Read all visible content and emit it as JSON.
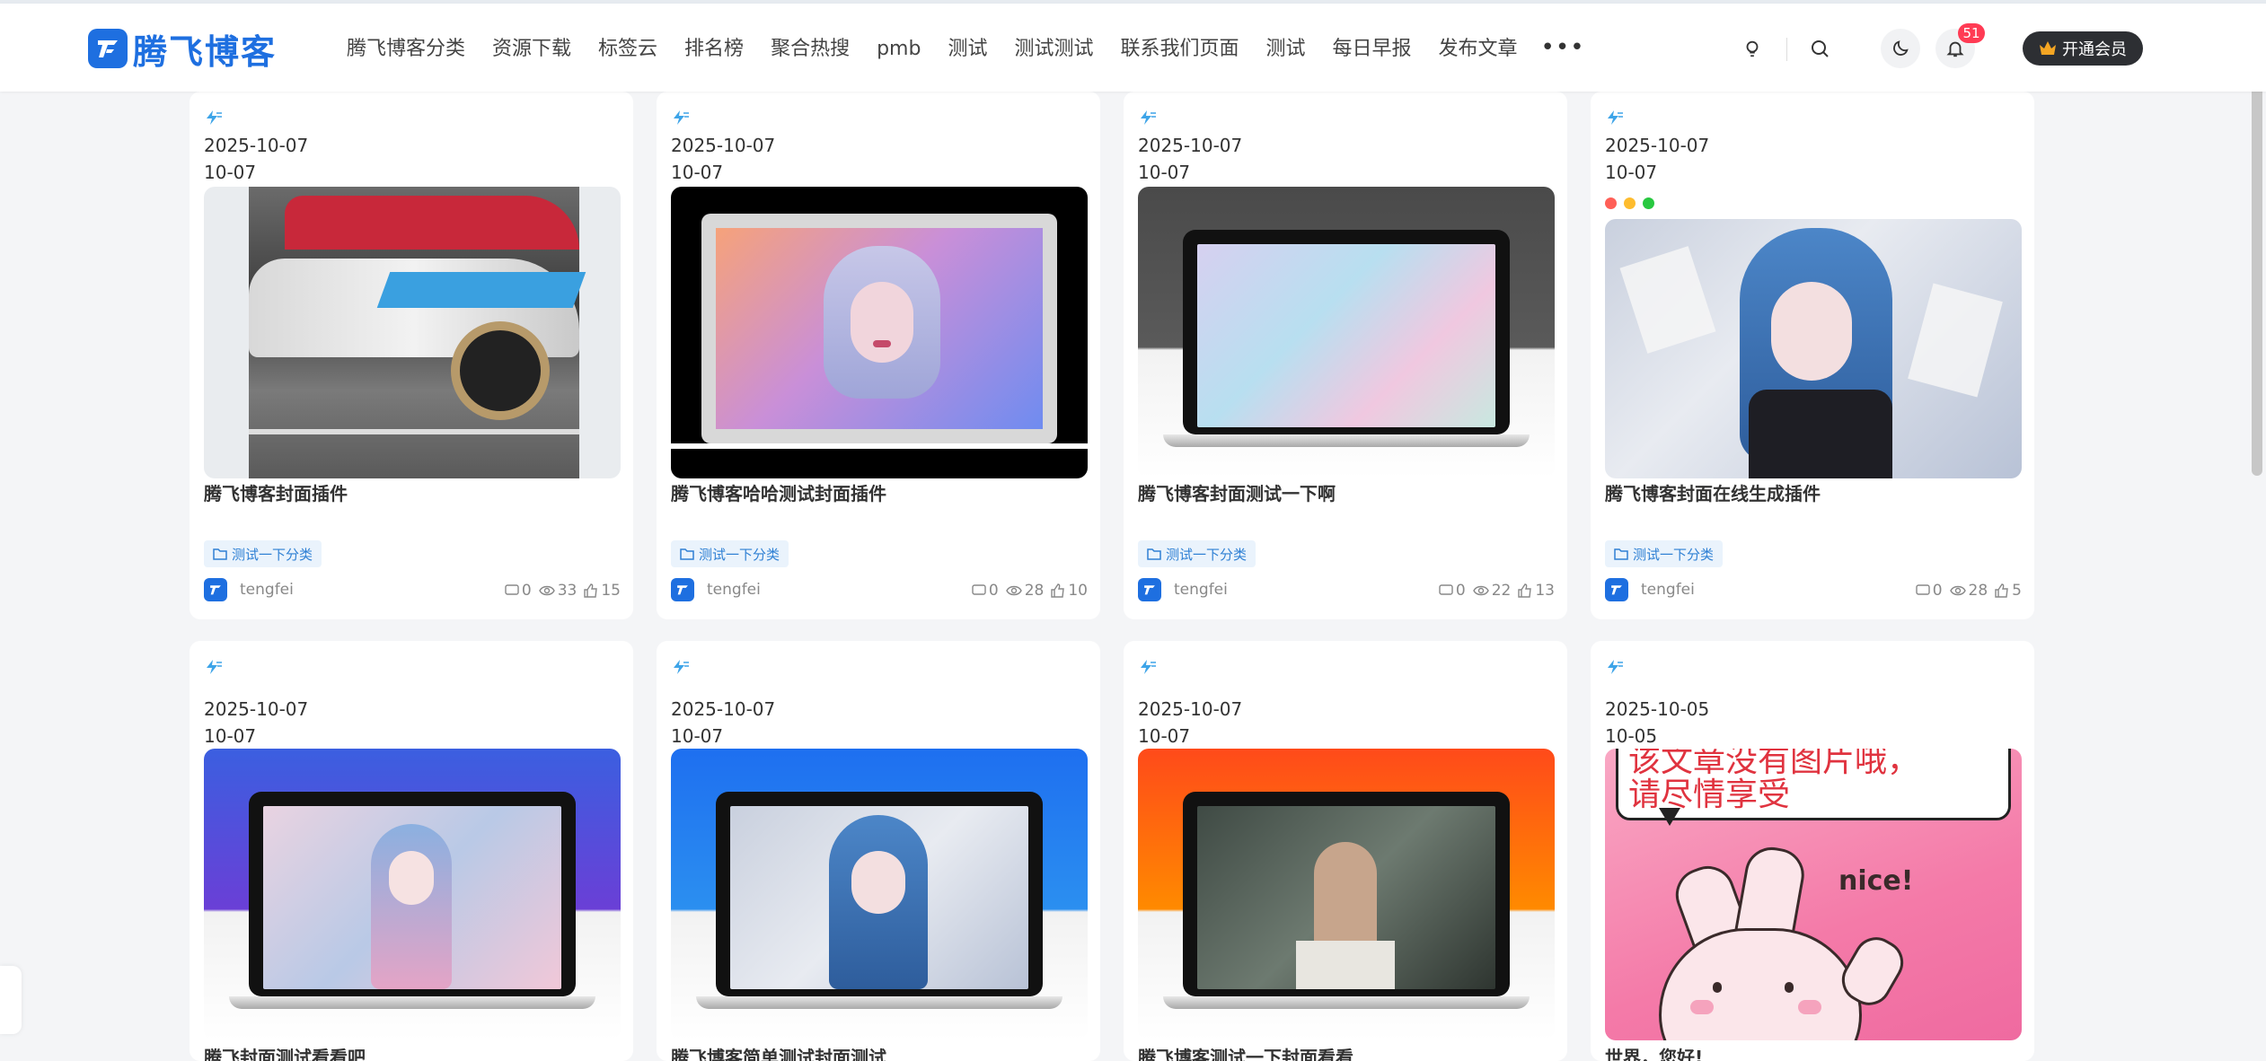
{
  "header": {
    "logo_text": "腾飞博客",
    "nav": [
      "腾飞博客分类",
      "资源下载",
      "标签云",
      "排名榜",
      "聚合热搜",
      "pmb",
      "测试",
      "测试测试",
      "联系我们页面",
      "测试",
      "每日早报",
      "发布文章"
    ],
    "more": "•••",
    "notification_count": "51",
    "vip_label": "开通会员"
  },
  "colors": {
    "brand": "#1e6fe0",
    "tag_bg": "#eaf3fc",
    "tag_text": "#2f80d4",
    "badge": "#ff3b54"
  },
  "cards": [
    {
      "date": "2025-10-07",
      "short_date": "10-07",
      "title": "腾飞博客封面插件",
      "category": "测试一下分类",
      "author": "tengfei",
      "comments": "0",
      "views": "33",
      "likes": "15",
      "cover": "sports-car-photo"
    },
    {
      "date": "2025-10-07",
      "short_date": "10-07",
      "title": "腾飞博客哈哈测试封面插件",
      "category": "测试一下分类",
      "author": "tengfei",
      "comments": "0",
      "views": "28",
      "likes": "10",
      "cover": "girl-portrait-framed"
    },
    {
      "date": "2025-10-07",
      "short_date": "10-07",
      "title": "腾飞博客封面测试一下啊",
      "category": "测试一下分类",
      "author": "tengfei",
      "comments": "0",
      "views": "22",
      "likes": "13",
      "cover": "laptop-gradient-screen"
    },
    {
      "date": "2025-10-07",
      "short_date": "10-07",
      "title": "腾飞博客封面在线生成插件",
      "category": "测试一下分类",
      "author": "tengfei",
      "comments": "0",
      "views": "28",
      "likes": "5",
      "cover": "window-girl-illustration"
    },
    {
      "date": "2025-10-07",
      "short_date": "10-07",
      "title": "腾飞封面测试看看吧",
      "cover": "laptop-purple"
    },
    {
      "date": "2025-10-07",
      "short_date": "10-07",
      "title": "腾飞博客简单测试封面测试",
      "cover": "laptop-blue"
    },
    {
      "date": "2025-10-07",
      "short_date": "10-07",
      "title": "腾飞博客测试一下封面看看",
      "cover": "laptop-orange"
    },
    {
      "date": "2025-10-05",
      "short_date": "10-05",
      "title": "世界，您好!",
      "cover": "rabbit-sticker",
      "cover_text_top": "该文章没有图片哦，",
      "cover_text": "请尽情享受",
      "cover_text_nice": "nice!"
    }
  ]
}
